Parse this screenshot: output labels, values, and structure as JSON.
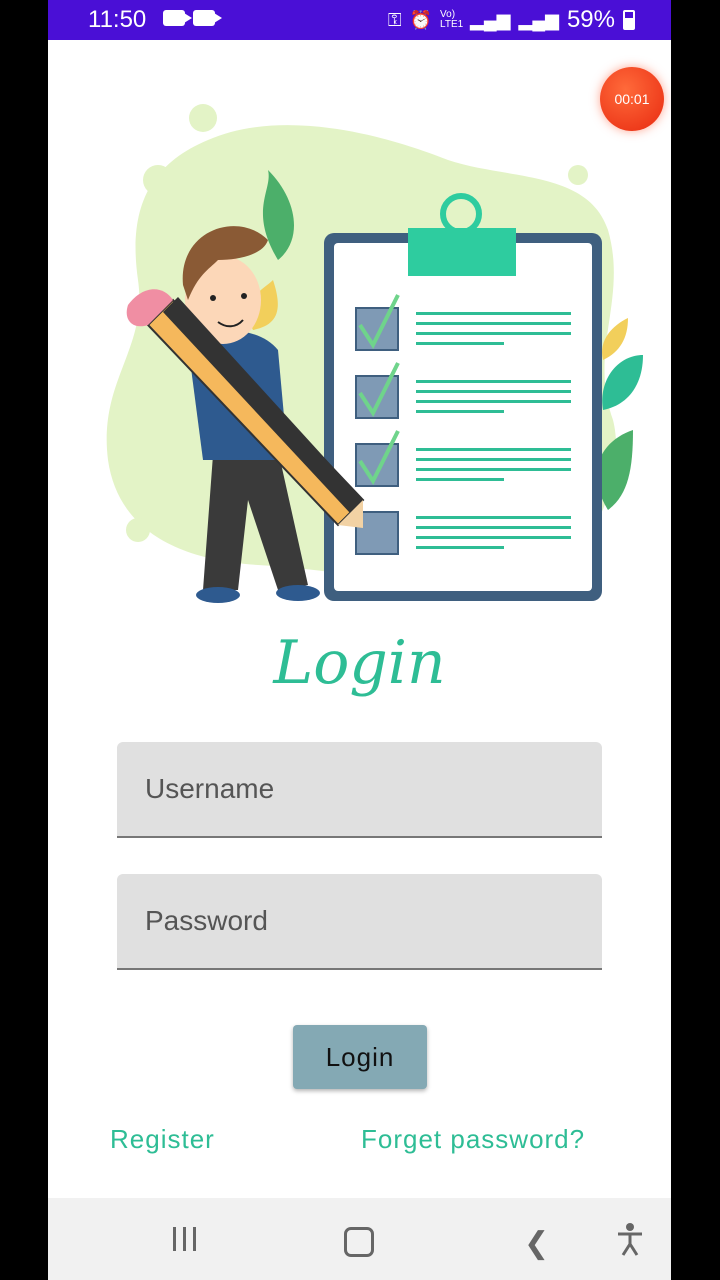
{
  "status_bar": {
    "time": "11:50",
    "network": "Vo) LTE1",
    "battery": "59%",
    "bg_color": "#4a0fd6"
  },
  "recorder": {
    "timer": "00:01"
  },
  "login": {
    "title": "Login",
    "username_placeholder": "Username",
    "password_placeholder": "Password",
    "button_label": "Login",
    "register_label": "Register",
    "forget_label": "Forget password?"
  },
  "colors": {
    "accent": "#2ebd95",
    "button": "#84a9b4",
    "field": "#e0e0e0"
  }
}
